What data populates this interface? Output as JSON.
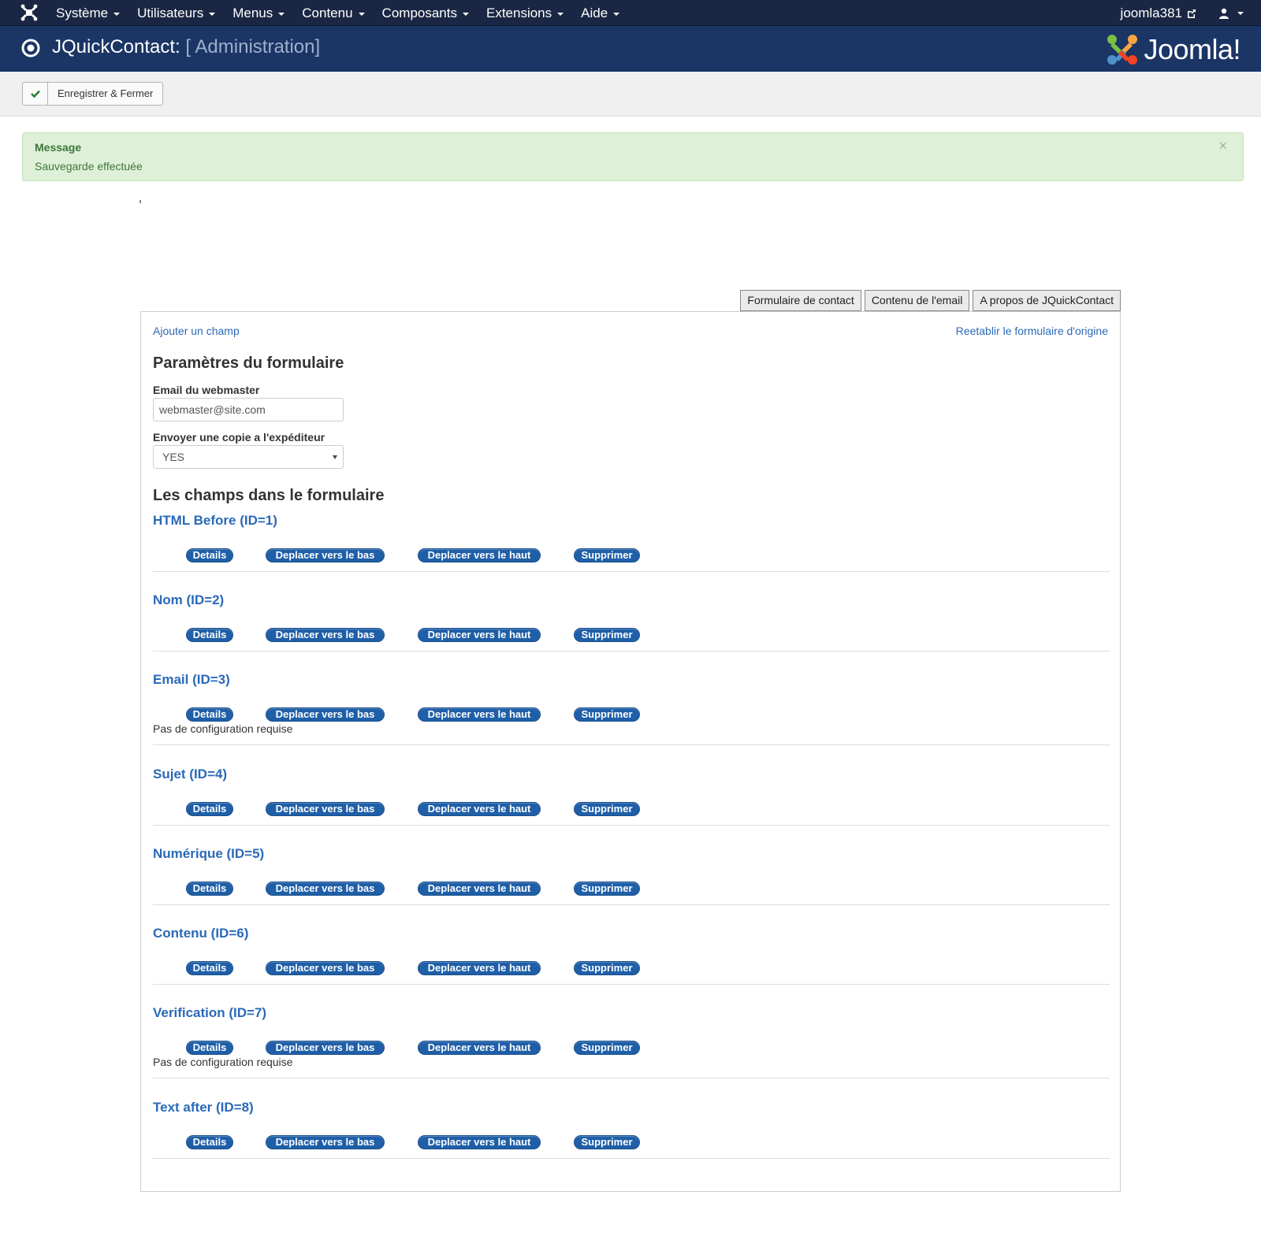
{
  "navbar": {
    "menu": [
      {
        "label": "Système",
        "name": "nav-systeme"
      },
      {
        "label": "Utilisateurs",
        "name": "nav-utilisateurs"
      },
      {
        "label": "Menus",
        "name": "nav-menus"
      },
      {
        "label": "Contenu",
        "name": "nav-contenu"
      },
      {
        "label": "Composants",
        "name": "nav-composants"
      },
      {
        "label": "Extensions",
        "name": "nav-extensions"
      },
      {
        "label": "Aide",
        "name": "nav-aide"
      }
    ],
    "site_name": "joomla381"
  },
  "header": {
    "title": "JQuickContact:",
    "subtitle": "[ Administration]",
    "brand": "Joomla!"
  },
  "toolbar": {
    "save_close_label": "Enregistrer & Fermer"
  },
  "alert": {
    "title": "Message",
    "text": "Sauvegarde effectuée",
    "close": "×"
  },
  "tabs": [
    {
      "label": "Formulaire de contact",
      "name": "tab-formulaire-contact"
    },
    {
      "label": "Contenu de l'email",
      "name": "tab-contenu-email"
    },
    {
      "label": "A propos de JQuickContact",
      "name": "tab-a-propos"
    }
  ],
  "panel": {
    "add_field": "Ajouter un champ",
    "reset_form": "Reetablir le formulaire d'origine",
    "params_heading": "Paramètres du formulaire",
    "email_label": "Email du webmaster",
    "email_value": "webmaster@site.com",
    "copy_label": "Envoyer une copie a l'expéditeur",
    "copy_value": "YES",
    "fields_heading": "Les champs dans le formulaire"
  },
  "actions": {
    "details": "Details",
    "move_down": "Deplacer vers le bas",
    "move_up": "Deplacer vers le haut",
    "delete": "Supprimer"
  },
  "fields": [
    {
      "title": "HTML Before (ID=1)",
      "note": ""
    },
    {
      "title": "Nom (ID=2)",
      "note": ""
    },
    {
      "title": "Email (ID=3)",
      "note": "Pas de configuration requise"
    },
    {
      "title": "Sujet (ID=4)",
      "note": ""
    },
    {
      "title": "Numérique (ID=5)",
      "note": ""
    },
    {
      "title": "Contenu (ID=6)",
      "note": ""
    },
    {
      "title": "Verification (ID=7)",
      "note": "Pas de configuration requise"
    },
    {
      "title": "Text after (ID=8)",
      "note": ""
    }
  ],
  "colors": {
    "navbar": "#1a2744",
    "header": "#1b3565",
    "link": "#2a69b8",
    "pill": "#1f5fa8",
    "alert_bg": "#dff0d8",
    "alert_text": "#3c763d"
  }
}
